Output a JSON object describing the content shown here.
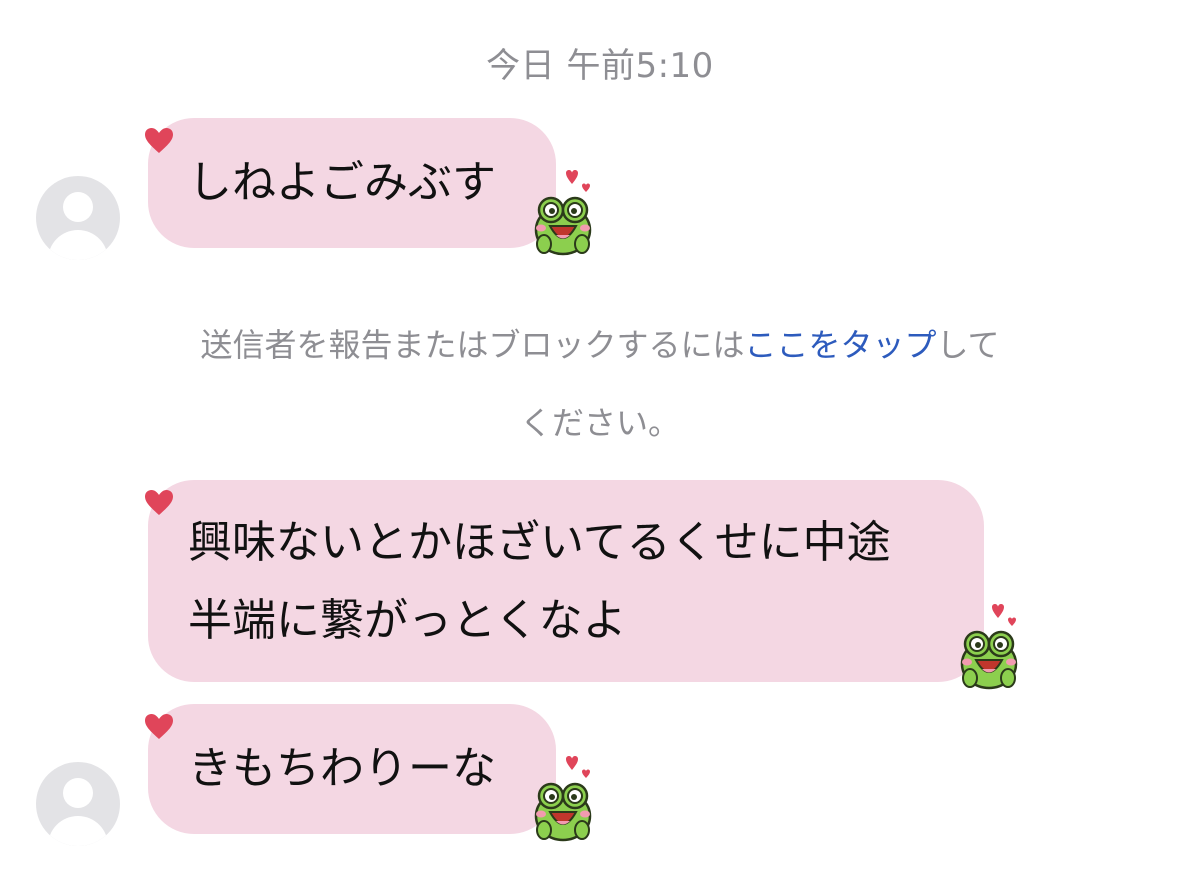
{
  "chat": {
    "timestamp": "今日 午前5:10",
    "messages": [
      {
        "text": "しねよごみぶす"
      },
      {
        "text": "興味ないとかほざいてるくせに中途\n半端に繋がっとくなよ"
      },
      {
        "text": "きもちわりーな"
      }
    ],
    "system_note": {
      "before": "送信者を報告またはブロックするには",
      "link": "ここをタップ",
      "after": "して\nください。"
    }
  },
  "colors": {
    "bubble": "#f4d7e3",
    "heart": "#e0455a",
    "link": "#2d5bbd",
    "muted_text": "#8e8e93",
    "frog": "#8ccf4e"
  },
  "icons": {
    "avatar": "default-user-avatar",
    "reaction": "heart-icon",
    "sticker": "frog-heart-sticker"
  }
}
